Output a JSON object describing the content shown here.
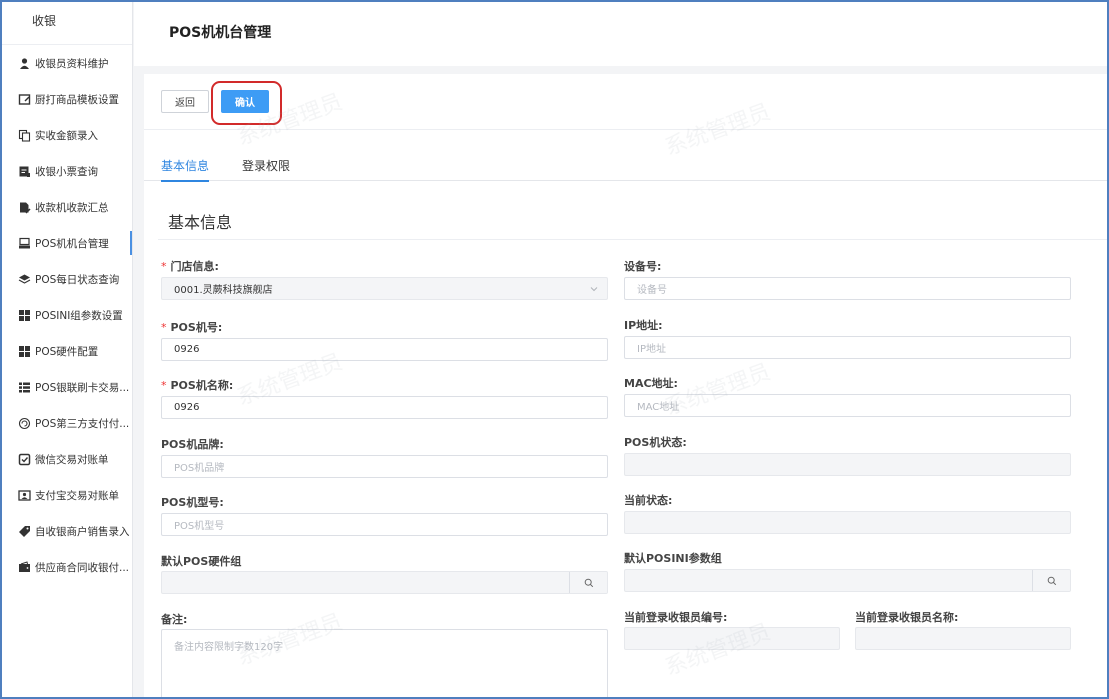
{
  "sidebar": {
    "header": "收银",
    "items": [
      {
        "label": "收银员资料维护",
        "icon": "user-icon"
      },
      {
        "label": "厨打商品模板设置",
        "icon": "template-icon"
      },
      {
        "label": "实收金额录入",
        "icon": "copy-icon"
      },
      {
        "label": "收银小票查询",
        "icon": "receipt-icon"
      },
      {
        "label": "收款机收款汇总",
        "icon": "document-edit-icon"
      },
      {
        "label": "POS机机台管理",
        "icon": "pos-terminal-icon",
        "active": true
      },
      {
        "label": "POS每日状态查询",
        "icon": "layers-icon"
      },
      {
        "label": "POSINI组参数设置",
        "icon": "grid-icon"
      },
      {
        "label": "POS硬件配置",
        "icon": "grid-icon"
      },
      {
        "label": "POS银联刷卡交易...",
        "icon": "list-icon"
      },
      {
        "label": "POS第三方支付付...",
        "icon": "refresh-circle-icon"
      },
      {
        "label": "微信交易对账单",
        "icon": "check-square-icon"
      },
      {
        "label": "支付宝交易对账单",
        "icon": "id-card-icon"
      },
      {
        "label": "自收银商户销售录入",
        "icon": "tag-icon"
      },
      {
        "label": "供应商合同收银付...",
        "icon": "wallet-icon"
      }
    ]
  },
  "header": {
    "title": "POS机机台管理"
  },
  "toolbar": {
    "back_label": "返回",
    "confirm_label": "确认"
  },
  "tabs": [
    {
      "label": "基本信息",
      "active": true
    },
    {
      "label": "登录权限"
    }
  ],
  "section_title": "基本信息",
  "form": {
    "store": {
      "label": "门店信息:",
      "value": "0001.灵蕨科技旗舰店",
      "required": true
    },
    "device_no": {
      "label": "设备号:",
      "placeholder": "设备号"
    },
    "pos_no": {
      "label": "POS机号:",
      "value": "0926",
      "required": true
    },
    "ip": {
      "label": "IP地址:",
      "placeholder": "IP地址"
    },
    "pos_name": {
      "label": "POS机名称:",
      "value": "0926",
      "required": true
    },
    "mac": {
      "label": "MAC地址:",
      "placeholder": "MAC地址"
    },
    "brand": {
      "label": "POS机品牌:",
      "placeholder": "POS机品牌"
    },
    "pos_status": {
      "label": "POS机状态:"
    },
    "model": {
      "label": "POS机型号:",
      "placeholder": "POS机型号"
    },
    "current_status": {
      "label": "当前状态:"
    },
    "hw_group": {
      "label": "默认POS硬件组"
    },
    "ini_group": {
      "label": "默认POSINI参数组"
    },
    "remark": {
      "label": "备注:",
      "placeholder": "备注内容限制字数120字"
    },
    "cashier_no": {
      "label": "当前登录收银员编号:"
    },
    "cashier_name": {
      "label": "当前登录收银员名称:"
    }
  },
  "watermark": "系统管理员",
  "colors": {
    "accent": "#3d9cf5",
    "tab_active": "#2f86e0",
    "highlight": "#d22a2a",
    "required": "#e33333"
  }
}
